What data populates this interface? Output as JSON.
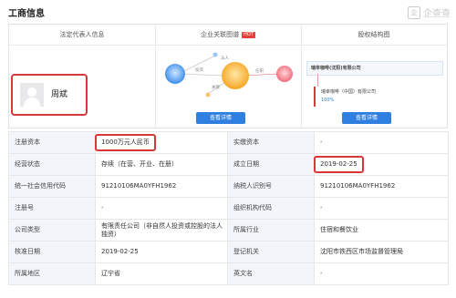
{
  "page_title": "工商信息",
  "brand": {
    "text": "企查查"
  },
  "sections": {
    "legal_rep_header": "法定代表人信息",
    "related_graph_header": "企业关联图谱",
    "hot_badge": "HOT",
    "equity_header": "股权结构图"
  },
  "legal_rep": {
    "name": "周斌"
  },
  "graph": {
    "label_investor": "投资",
    "label_position": "任职",
    "label_related": "关联",
    "label_other": "法人"
  },
  "equity": {
    "company": "瑞幸咖啡(沈阳)有限公司",
    "shareholder": "瑞幸咖啡（中国）有限公司",
    "percent": "100%"
  },
  "buttons": {
    "view_details_1": "查看详情",
    "view_details_2": "查看详情"
  },
  "table": [
    {
      "l1": "注册资本",
      "v1": "1000万元人民币",
      "l2": "实缴资本",
      "v2": "-"
    },
    {
      "l1": "经营状态",
      "v1": "存续（在营、开业、在册）",
      "l2": "成立日期",
      "v2": "2019-02-25"
    },
    {
      "l1": "统一社会信用代码",
      "v1": "91210106MA0YFH1962",
      "l2": "纳税人识别号",
      "v2": "91210106MA0YFH1962"
    },
    {
      "l1": "注册号",
      "v1": "-",
      "l2": "组织机构代码",
      "v2": "-"
    },
    {
      "l1": "公司类型",
      "v1": "有限责任公司（非自然人投资或控股的法人独资）",
      "l2": "所属行业",
      "v2": "住宿和餐饮业"
    },
    {
      "l1": "核准日期",
      "v1": "2019-02-25",
      "l2": "登记机关",
      "v2": "沈阳市铁西区市场监督管理局"
    },
    {
      "l1": "所属地区",
      "v1": "辽宁省",
      "l2": "英文名",
      "v2": "-"
    }
  ],
  "colors": {
    "highlight": "#d9383a",
    "button": "#2f7fe0",
    "label_bg": "#f2f6fb"
  }
}
